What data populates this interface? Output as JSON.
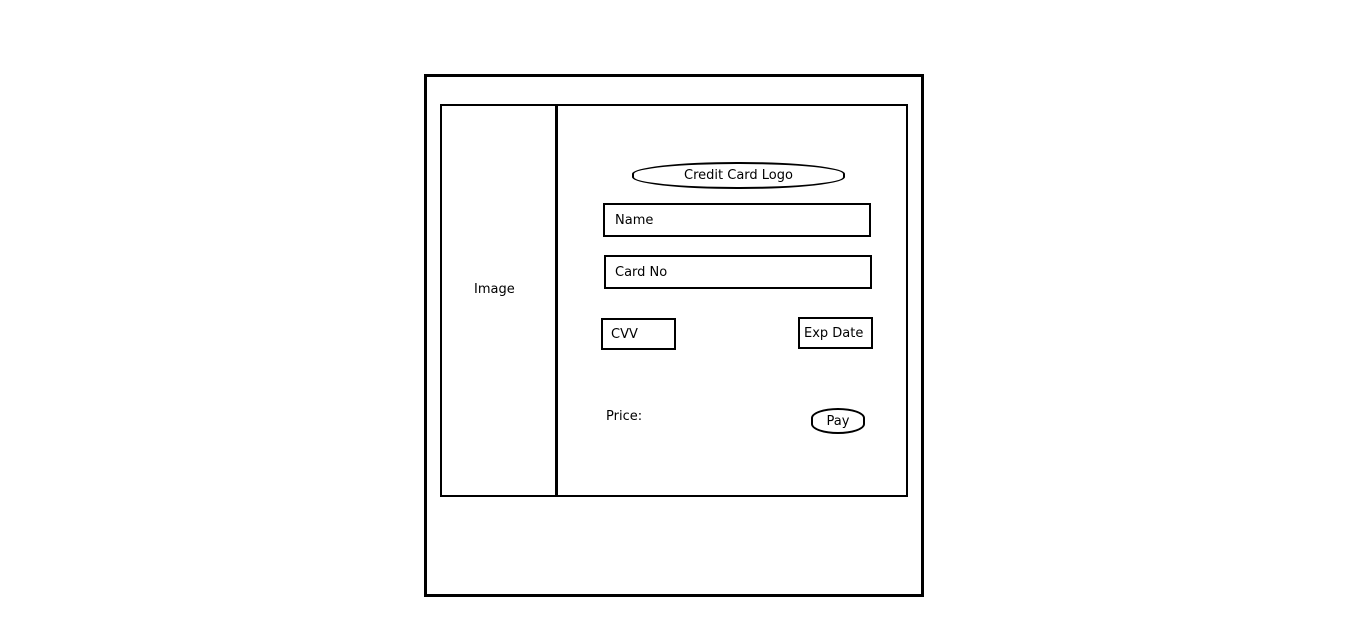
{
  "image_panel": {
    "label": "Image"
  },
  "payment_form": {
    "logo_label": "Credit Card Logo",
    "name_placeholder": "Name",
    "card_no_placeholder": "Card No",
    "cvv_placeholder": "CVV",
    "exp_date_placeholder": "Exp Date",
    "price_label": "Price:",
    "pay_label": "Pay"
  }
}
